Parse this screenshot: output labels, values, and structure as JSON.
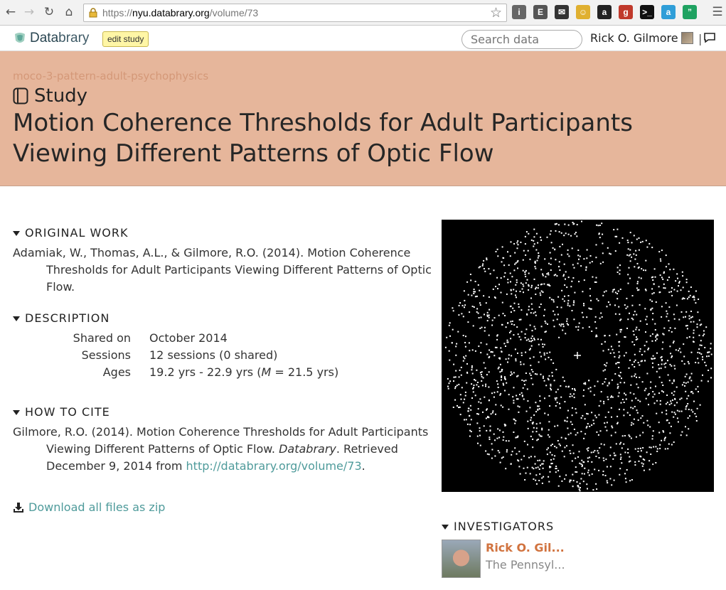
{
  "browser": {
    "url_scheme": "https://",
    "url_host": "nyu.databrary.org",
    "url_path": "/volume/73",
    "extensions": [
      {
        "name": "info-icon",
        "color": "#666"
      },
      {
        "name": "evernote-icon",
        "color": "#555"
      },
      {
        "name": "cart-icon",
        "color": "#333"
      },
      {
        "name": "cat-icon",
        "color": "#e0b030"
      },
      {
        "name": "amazon-icon",
        "color": "#222"
      },
      {
        "name": "gplus-icon",
        "color": "#c0392b"
      },
      {
        "name": "terminal-icon",
        "color": "#111"
      },
      {
        "name": "a-icon",
        "color": "#2f9ed8"
      },
      {
        "name": "hangouts-icon",
        "color": "#1fa261"
      }
    ]
  },
  "header": {
    "logo_part1": "Data",
    "logo_part2": "brary",
    "edit_label": "edit study",
    "search_placeholder": "Search data",
    "user_name": "Rick O. Gilmore",
    "separator": "|"
  },
  "banner": {
    "volume_name": "moco-3-pattern-adult-psychophysics",
    "kind": "Study",
    "title": "Motion Coherence Thresholds for Adult Participants Viewing Different Patterns of Optic Flow",
    "bg_color": "#e6b69b"
  },
  "original_work": {
    "heading": "ORIGINAL WORK",
    "citation": "Adamiak, W., Thomas, A.L., & Gilmore, R.O. (2014). Motion Coherence Thresholds for Adult Participants Viewing Different Patterns of Optic Flow."
  },
  "description": {
    "heading": "DESCRIPTION",
    "shared_label": "Shared on",
    "shared_value": "October 2014",
    "sessions_label": "Sessions",
    "sessions_value": "12 sessions (0 shared)",
    "ages_label": "Ages",
    "ages_prefix": "19.2 yrs - 22.9 yrs (",
    "ages_m": "M",
    "ages_suffix": " = 21.5 yrs)"
  },
  "cite": {
    "heading": "HOW TO CITE",
    "text_a": "Gilmore, R.O. (2014). Motion Coherence Thresholds for Adult Participants Viewing Different Patterns of Optic Flow. ",
    "journal": "Databrary",
    "text_b": ". Retrieved December 9, 2014 from ",
    "link": "http://databrary.org/volume/73",
    "text_c": "."
  },
  "download_label": "Download all files as zip",
  "investigators": {
    "heading": "INVESTIGATORS",
    "name": "Rick O. Gil...",
    "affiliation": "The Pennsyl..."
  }
}
